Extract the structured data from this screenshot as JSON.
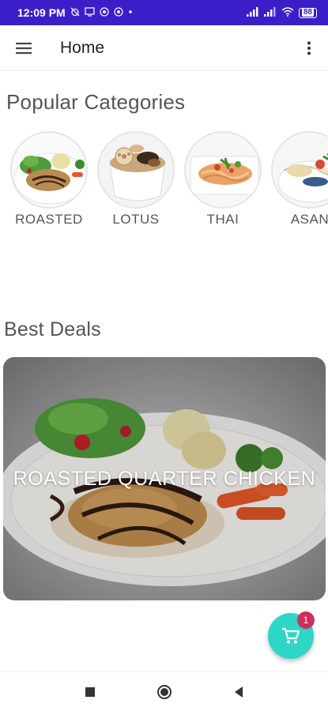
{
  "status_bar": {
    "time": "12:09 PM",
    "left_icons": [
      "alarm-off-icon",
      "screen-cast-icon",
      "app-icon",
      "app-icon",
      "dot-icon"
    ],
    "right_icons": [
      "signal-icon",
      "signal-icon",
      "wifi-icon",
      "battery-icon"
    ],
    "battery": "88",
    "color": "#3b1ec7"
  },
  "app_bar": {
    "title": "Home"
  },
  "categories": {
    "title": "Popular Categories",
    "items": [
      {
        "label": "ROASTED"
      },
      {
        "label": "LOTUS"
      },
      {
        "label": "THAI"
      },
      {
        "label": "ASAN"
      }
    ]
  },
  "deals": {
    "title": "Best Deals",
    "items": [
      {
        "label": "ROASTED QUARTER CHICKEN"
      }
    ]
  },
  "cart": {
    "count": "1",
    "fab_color": "#2ed6c6",
    "badge_color": "#cc2f5a"
  }
}
